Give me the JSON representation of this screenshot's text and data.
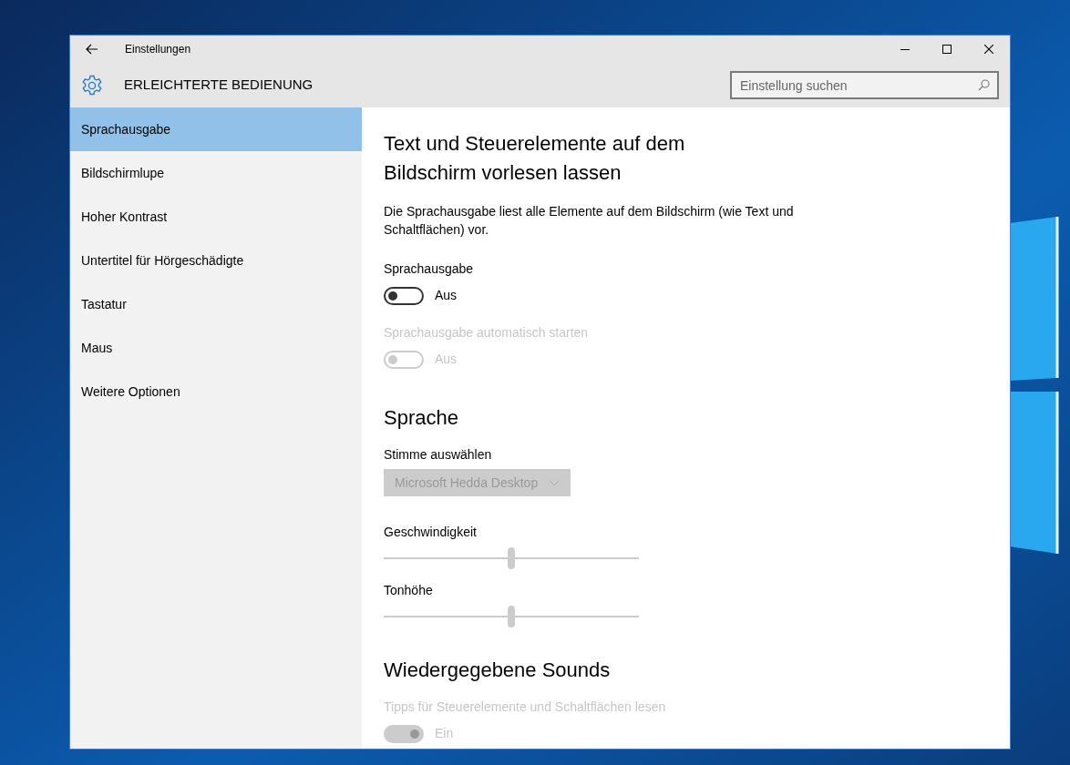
{
  "window": {
    "title": "Einstellungen"
  },
  "header": {
    "title": "ERLEICHTERTE BEDIENUNG",
    "search": {
      "placeholder": "Einstellung suchen"
    }
  },
  "sidebar": {
    "items": [
      {
        "label": "Sprachausgabe",
        "selected": true
      },
      {
        "label": "Bildschirmlupe",
        "selected": false
      },
      {
        "label": "Hoher Kontrast",
        "selected": false
      },
      {
        "label": "Untertitel für Hörgeschädigte",
        "selected": false
      },
      {
        "label": "Tastatur",
        "selected": false
      },
      {
        "label": "Maus",
        "selected": false
      },
      {
        "label": "Weitere Optionen",
        "selected": false
      }
    ]
  },
  "content": [
    {
      "kind": "heading",
      "text": "Text und Steuerelemente auf dem Bildschirm vorlesen lassen"
    },
    {
      "kind": "paragraph",
      "text": "Die Sprachausgabe liest alle Elemente auf dem Bildschirm (wie Text und Schaltflächen) vor."
    },
    {
      "kind": "label",
      "text": "Sprachausgabe",
      "disabled": false
    },
    {
      "kind": "toggle",
      "on": false,
      "disabled": false,
      "text": "Aus"
    },
    {
      "kind": "label",
      "text": "Sprachausgabe automatisch starten",
      "disabled": true
    },
    {
      "kind": "toggle",
      "on": false,
      "disabled": true,
      "text": "Aus"
    },
    {
      "kind": "heading",
      "text": "Sprache"
    },
    {
      "kind": "label",
      "text": "Stimme auswählen",
      "disabled": false
    },
    {
      "kind": "dropdown",
      "text": "Microsoft Hedda Desktop",
      "disabled": true
    },
    {
      "kind": "label",
      "text": "Geschwindigkeit",
      "disabled": false
    },
    {
      "kind": "slider",
      "level": 0.5,
      "disabled": true
    },
    {
      "kind": "label",
      "text": "Tonhöhe",
      "disabled": false
    },
    {
      "kind": "slider",
      "level": 0.5,
      "disabled": true
    },
    {
      "kind": "heading",
      "text": "Wiedergegebene Sounds"
    },
    {
      "kind": "label",
      "text": "Tipps für Steuerelemente und Schaltflächen lesen",
      "disabled": true
    },
    {
      "kind": "toggle",
      "on": true,
      "disabled": true,
      "text": "Ein"
    }
  ]
}
